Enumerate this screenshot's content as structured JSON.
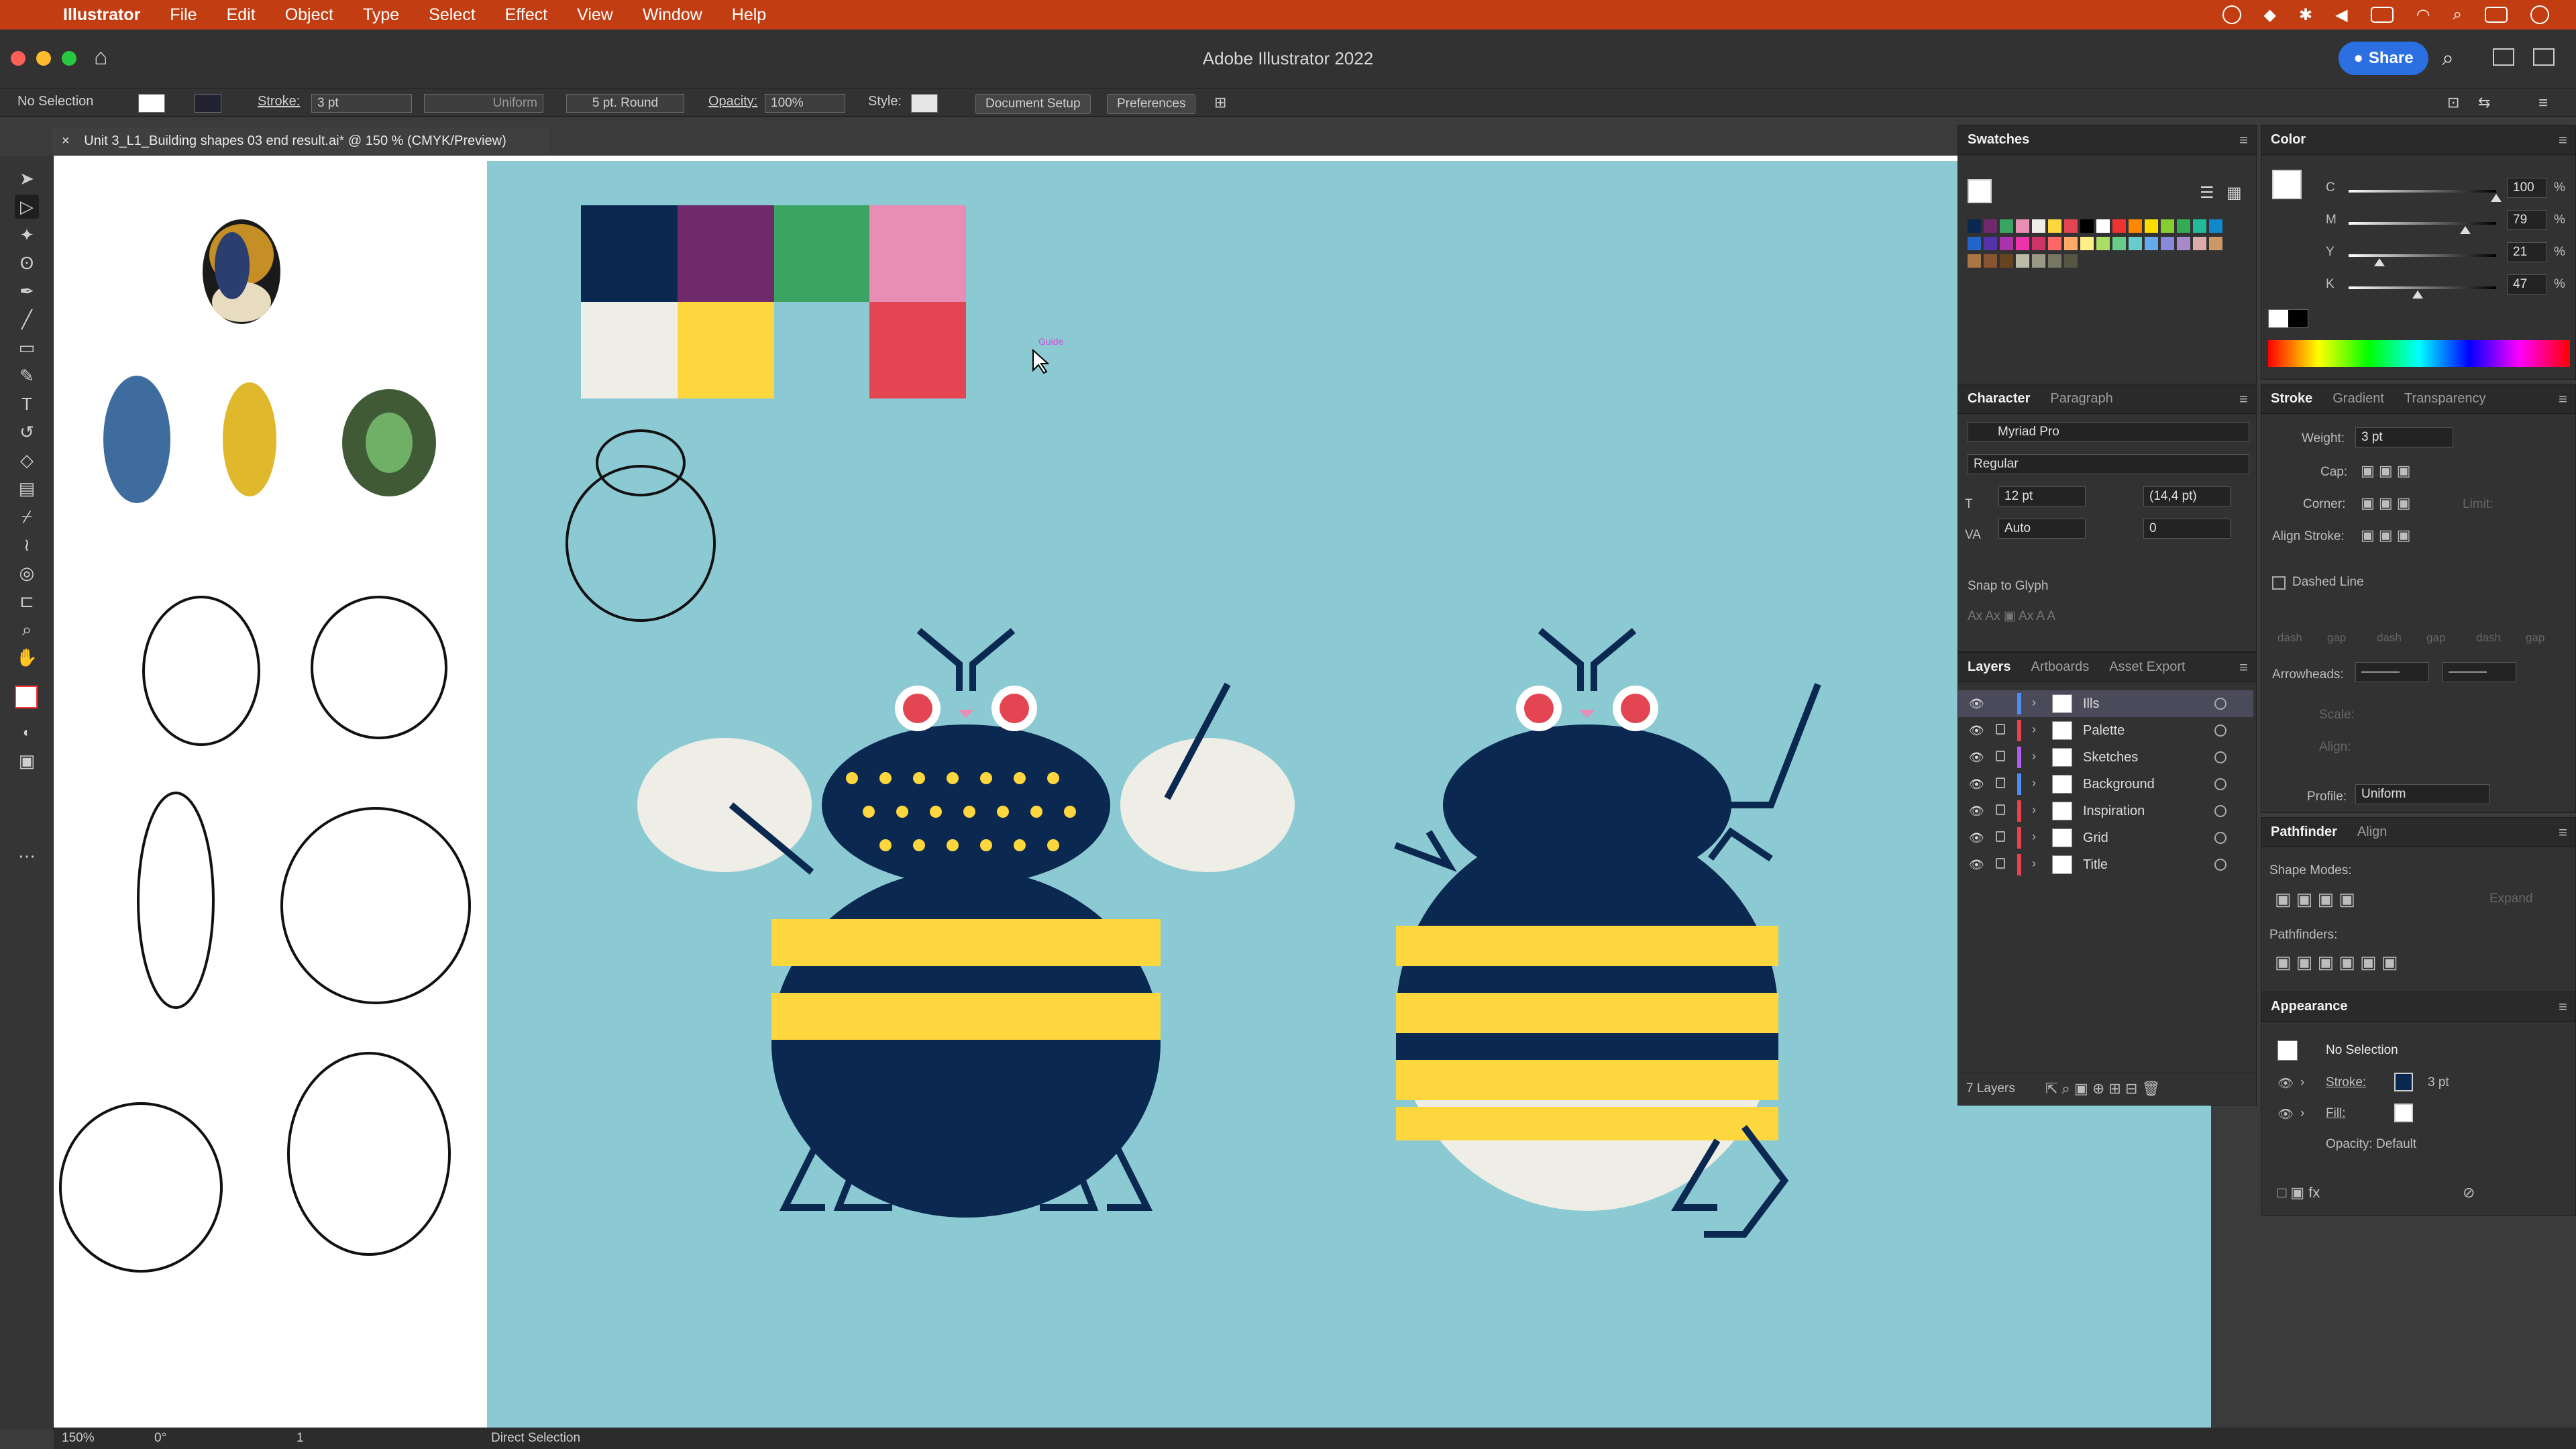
{
  "menubar": {
    "app": "Illustrator",
    "items": [
      "File",
      "Edit",
      "Object",
      "Type",
      "Select",
      "Effect",
      "View",
      "Window",
      "Help"
    ]
  },
  "window": {
    "title": "Adobe Illustrator 2022",
    "share_label": "Share"
  },
  "control": {
    "selection": "No Selection",
    "stroke_label": "Stroke:",
    "stroke_value": "3 pt",
    "profile": "Uniform",
    "brush": "5 pt. Round",
    "opacity_label": "Opacity:",
    "opacity_value": "100%",
    "style_label": "Style:",
    "doc_setup": "Document Setup",
    "preferences": "Preferences"
  },
  "document": {
    "tab_title": "Unit 3_L1_Building shapes 03 end result.ai* @ 150 % (CMYK/Preview)",
    "palette_colors": [
      "#0b2850",
      "#6e2a6a",
      "#3aa563",
      "#e88eb5",
      "#efeee6",
      "#fed63e",
      "#e34652"
    ]
  },
  "swatches": {
    "title": "Swatches"
  },
  "color": {
    "title": "Color",
    "channels": [
      {
        "name": "C",
        "value": "100"
      },
      {
        "name": "M",
        "value": "79"
      },
      {
        "name": "Y",
        "value": "21"
      },
      {
        "name": "K",
        "value": "47"
      }
    ],
    "unit": "%"
  },
  "character": {
    "tabs": [
      "Character",
      "Paragraph"
    ],
    "font": "Myriad Pro",
    "style": "Regular",
    "size": "12 pt",
    "leading": "(14,4 pt)",
    "kerning": "Auto",
    "tracking": "0",
    "snap_label": "Snap to Glyph"
  },
  "stroke_panel": {
    "tabs": [
      "Stroke",
      "Gradient",
      "Transparency"
    ],
    "weight_label": "Weight:",
    "weight_value": "3 pt",
    "cap_label": "Cap:",
    "corner_label": "Corner:",
    "limit_label": "Limit:",
    "align_label": "Align Stroke:",
    "dashed_label": "Dashed Line",
    "dash_labels": [
      "dash",
      "gap",
      "dash",
      "gap",
      "dash",
      "gap"
    ],
    "arrowheads_label": "Arrowheads:",
    "scale_label": "Scale:",
    "align2_label": "Align:",
    "profile_label": "Profile:",
    "profile_value": "Uniform"
  },
  "layers": {
    "tabs": [
      "Layers",
      "Artboards",
      "Asset Export"
    ],
    "items": [
      {
        "name": "Ills",
        "color": "#4e8df5",
        "locked": false
      },
      {
        "name": "Palette",
        "color": "#e8424b",
        "locked": true
      },
      {
        "name": "Sketches",
        "color": "#b35cf0",
        "locked": true
      },
      {
        "name": "Background",
        "color": "#4e8df5",
        "locked": true
      },
      {
        "name": "Inspiration",
        "color": "#e8424b",
        "locked": true
      },
      {
        "name": "Grid",
        "color": "#e8424b",
        "locked": true
      },
      {
        "name": "Title",
        "color": "#e8424b",
        "locked": true
      }
    ],
    "count": "7 Layers"
  },
  "pathfinder": {
    "tabs": [
      "Pathfinder",
      "Align"
    ],
    "shape_modes": "Shape Modes:",
    "expand": "Expand",
    "pathfinders": "Pathfinders:"
  },
  "appearance": {
    "title": "Appearance",
    "selection": "No Selection",
    "stroke_label": "Stroke:",
    "stroke_value": "3 pt",
    "fill_label": "Fill:",
    "opacity": "Opacity: Default"
  },
  "status": {
    "zoom": "150%",
    "rotation": "0°",
    "artboard": "1",
    "tool": "Direct Selection"
  },
  "cursor_label": "Guide"
}
